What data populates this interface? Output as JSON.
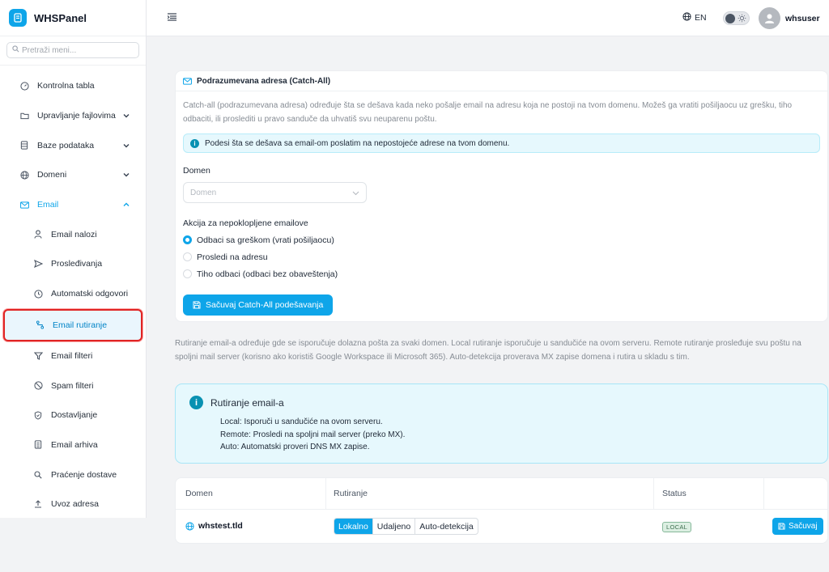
{
  "brand": {
    "name": "WHSPanel"
  },
  "search": {
    "placeholder": "Pretraži meni..."
  },
  "sidebar": {
    "items": [
      {
        "label": "Kontrolna tabla",
        "icon": "gauge-icon"
      },
      {
        "label": "Upravljanje fajlovima",
        "icon": "folder-icon"
      },
      {
        "label": "Baze podataka",
        "icon": "database-icon"
      },
      {
        "label": "Domeni",
        "icon": "globe-icon"
      },
      {
        "label": "Email",
        "icon": "mail-icon"
      }
    ],
    "email_sub": [
      {
        "label": "Email nalozi",
        "icon": "user-icon"
      },
      {
        "label": "Prosleđivanja",
        "icon": "send-icon"
      },
      {
        "label": "Automatski odgovori",
        "icon": "clock-icon"
      },
      {
        "label": "Email rutiranje",
        "icon": "route-icon"
      },
      {
        "label": "Email filteri",
        "icon": "filter-icon"
      },
      {
        "label": "Spam filteri",
        "icon": "ban-icon"
      },
      {
        "label": "Dostavljanje",
        "icon": "shield-icon"
      },
      {
        "label": "Email arhiva",
        "icon": "archive-icon"
      },
      {
        "label": "Praćenje dostave",
        "icon": "search-icon"
      },
      {
        "label": "Uvoz adresa",
        "icon": "upload-icon"
      }
    ]
  },
  "topbar": {
    "lang": "EN",
    "username": "whsuser"
  },
  "catch_all": {
    "title": "Podrazumevana adresa (Catch-All)",
    "description": "Catch-all (podrazumevana adresa) određuje šta se dešava kada neko pošalje email na adresu koja ne postoji na tvom domenu. Možeš ga vratiti pošiljaocu uz grešku, tiho odbaciti, ili proslediti u pravo sanduče da uhvatiš svu neuparenu poštu.",
    "info": "Podesi šta se dešava sa email-om poslatim na nepostojeće adrese na tvom domenu.",
    "domain_label": "Domen",
    "domain_placeholder": "Domen",
    "action_label": "Akcija za nepoklopljene emailove",
    "options": [
      {
        "label": "Odbaci sa greškom (vrati pošiljaocu)",
        "selected": true
      },
      {
        "label": "Prosledi na adresu",
        "selected": false
      },
      {
        "label": "Tiho odbaci (odbaci bez obaveštenja)",
        "selected": false
      }
    ],
    "save_label": "Sačuvaj Catch-All podešavanja"
  },
  "routing": {
    "description": "Rutiranje email-a određuje gde se isporučuje dolazna pošta za svaki domen. Local rutiranje isporučuje u sandučiće na ovom serveru. Remote rutiranje prosleđuje svu poštu na spoljni mail server (korisno ako koristiš Google Workspace ili Microsoft 365). Auto-detekcija proverava MX zapise domena i rutira u skladu s tim.",
    "info_title": "Rutiranje email-a",
    "info_lines": [
      "Local: Isporuči u sandučiće na ovom serveru.",
      "Remote: Prosledi na spoljni mail server (preko MX).",
      "Auto: Automatski proveri DNS MX zapise."
    ],
    "table": {
      "headers": [
        "Domen",
        "Rutiranje",
        "Status"
      ],
      "rows": [
        {
          "domain": "whstest.tld",
          "options": [
            "Lokalno",
            "Udaljeno",
            "Auto-detekcija"
          ],
          "selected": 0,
          "status": "LOCAL",
          "save_label": "Sačuvaj"
        }
      ]
    }
  },
  "colors": {
    "accent": "#0ea5e9",
    "info_bg": "#e6f8fd",
    "highlight_border": "#e02424"
  }
}
